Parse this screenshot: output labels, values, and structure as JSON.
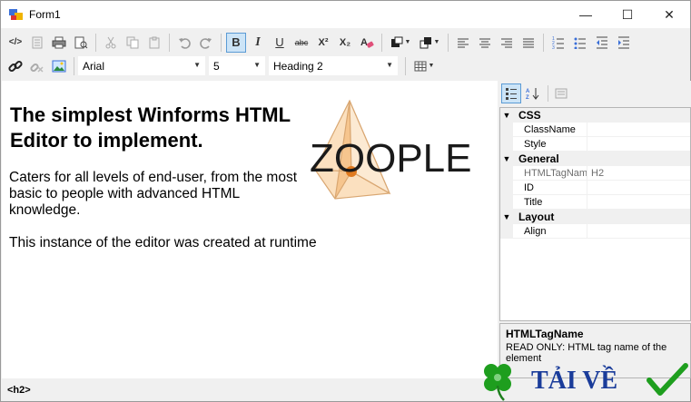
{
  "window": {
    "title": "Form1",
    "min_glyph": "—",
    "max_glyph": "☐",
    "close_glyph": "✕"
  },
  "toolbar1": {
    "source": "</>",
    "bold": "B",
    "italic": "I",
    "underline": "U",
    "strike": "abc",
    "superscript": "X²",
    "subscript": "X₂"
  },
  "toolbar2": {
    "font": "Arial",
    "size": "5",
    "style": "Heading 2"
  },
  "document": {
    "heading": "The simplest Winforms HTML Editor to implement.",
    "para1": "Caters for all levels of end-user, from the most basic to people with advanced HTML knowledge.",
    "para2": "This instance of the editor was created at runtime",
    "logo_text": "ZOOPLE"
  },
  "propgrid": {
    "categories": [
      {
        "name": "CSS",
        "props": [
          {
            "name": "ClassName",
            "value": "",
            "readonly": false
          },
          {
            "name": "Style",
            "value": "",
            "readonly": false
          }
        ]
      },
      {
        "name": "General",
        "props": [
          {
            "name": "HTMLTagNam",
            "value": "H2",
            "readonly": true
          },
          {
            "name": "ID",
            "value": "",
            "readonly": false
          },
          {
            "name": "Title",
            "value": "",
            "readonly": false
          }
        ]
      },
      {
        "name": "Layout",
        "props": [
          {
            "name": "Align",
            "value": "",
            "readonly": false
          }
        ]
      }
    ],
    "desc_title": "HTMLTagName",
    "desc_text": "READ ONLY: HTML tag name of the element"
  },
  "status": {
    "tag": "<h2>"
  },
  "watermark": {
    "text": "TẢI VỀ"
  },
  "colors": {
    "accent": "#cce4f7",
    "accent_border": "#5b9bd5",
    "logo_orange": "#f5b060",
    "watermark_blue": "#1a3c9a",
    "watermark_green": "#1e9e1e"
  }
}
